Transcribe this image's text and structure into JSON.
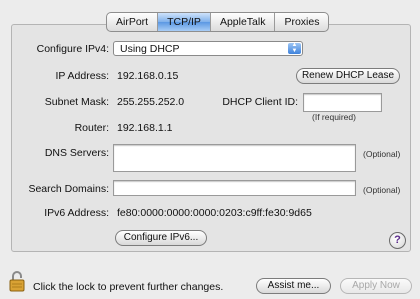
{
  "tabs": [
    "AirPort",
    "TCP/IP",
    "AppleTalk",
    "Proxies"
  ],
  "configure": {
    "label": "Configure IPv4:",
    "value": "Using DHCP"
  },
  "ip": {
    "label": "IP Address:",
    "value": "192.168.0.15"
  },
  "renew_button": "Renew DHCP Lease",
  "subnet": {
    "label": "Subnet Mask:",
    "value": "255.255.252.0"
  },
  "dhcp_client": {
    "label": "DHCP Client ID:",
    "value": "",
    "hint": "(If required)"
  },
  "router": {
    "label": "Router:",
    "value": "192.168.1.1"
  },
  "dns": {
    "label": "DNS Servers:",
    "value": "",
    "optional": "(Optional)"
  },
  "search": {
    "label": "Search Domains:",
    "value": "",
    "optional": "(Optional)"
  },
  "ipv6": {
    "label": "IPv6 Address:",
    "value": "fe80:0000:0000:0000:0203:c9ff:fe30:9d65"
  },
  "configure_ipv6_button": "Configure IPv6...",
  "help_glyph": "?",
  "footer": {
    "lock_text": "Click the lock to prevent further changes.",
    "assist_button": "Assist me...",
    "apply_button": "Apply Now"
  }
}
